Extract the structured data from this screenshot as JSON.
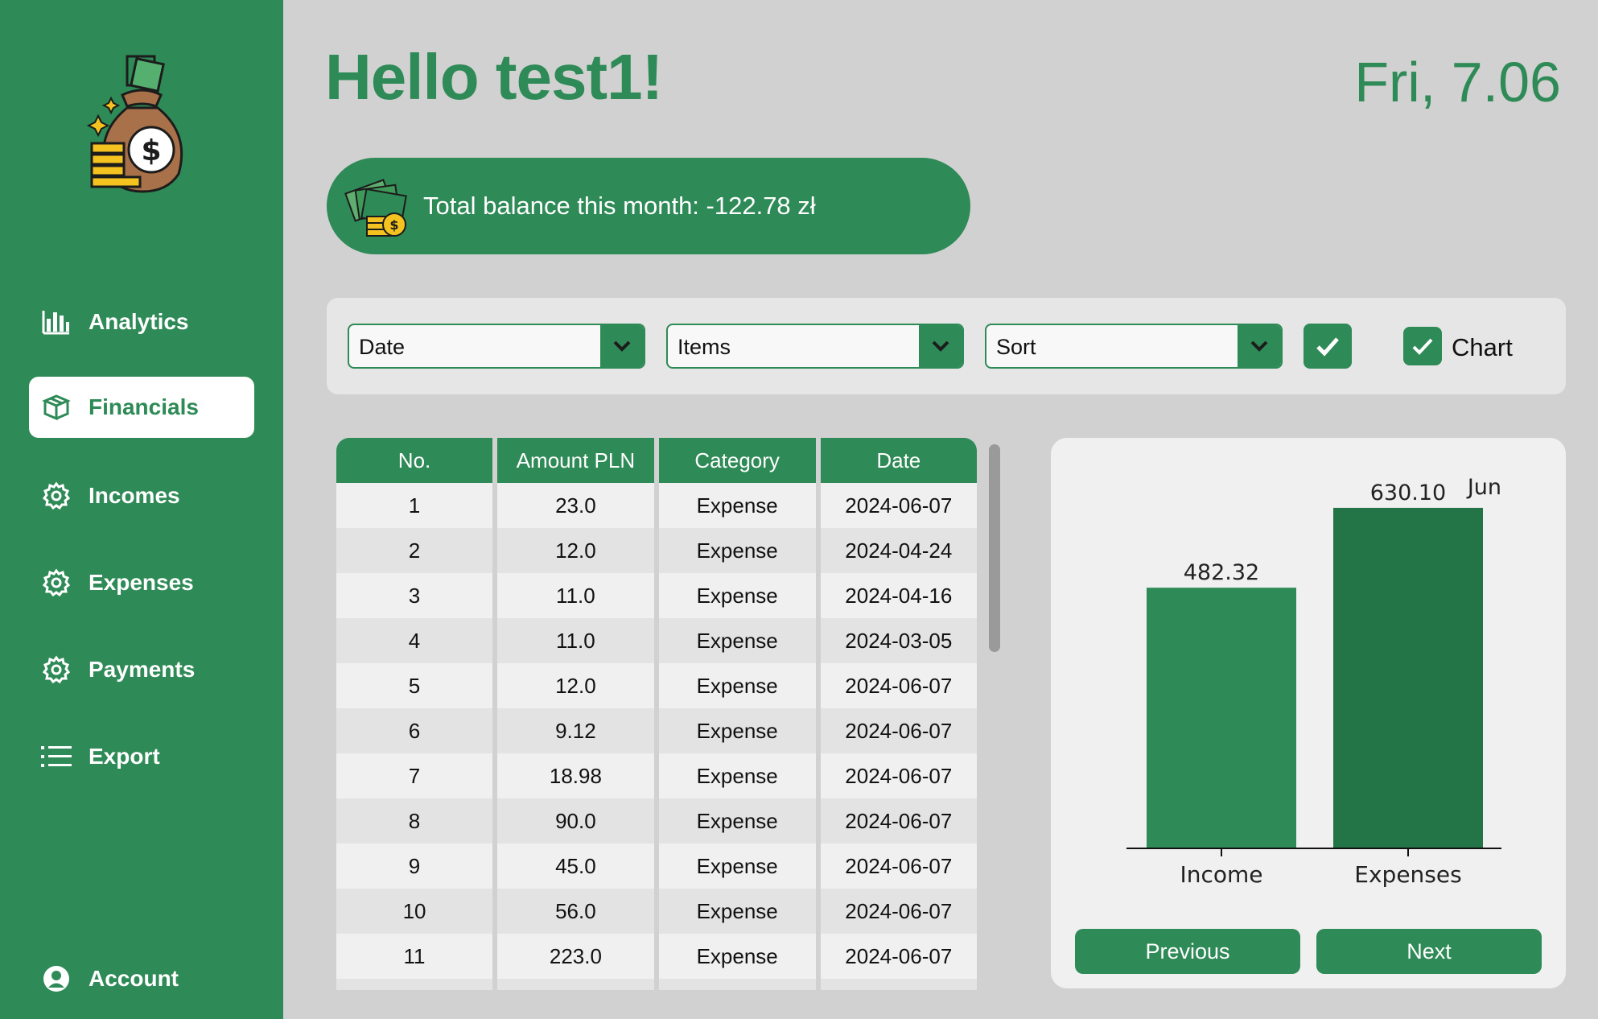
{
  "sidebar": {
    "logo_icon": "money-bag-icon",
    "items": [
      {
        "label": "Analytics",
        "icon": "bar-chart-icon"
      },
      {
        "label": "Financials",
        "icon": "box-icon",
        "active": true
      },
      {
        "label": "Incomes",
        "icon": "gear-icon"
      },
      {
        "label": "Expenses",
        "icon": "gear-icon"
      },
      {
        "label": "Payments",
        "icon": "gear-icon"
      },
      {
        "label": "Export",
        "icon": "list-icon"
      }
    ],
    "account": {
      "label": "Account",
      "icon": "user-icon"
    }
  },
  "header": {
    "greeting": "Hello test1!",
    "date": "Fri, 7.06"
  },
  "balance": {
    "text": "Total balance this month: -122.78 zł",
    "icon": "cash-coins-icon"
  },
  "filters": {
    "date_select": "Date",
    "items_select": "Items",
    "sort_select": "Sort",
    "apply_icon": "check-icon",
    "chart_checkbox_label": "Chart",
    "chart_checked": true
  },
  "table": {
    "headers": [
      "No.",
      "Amount PLN",
      "Category",
      "Date"
    ],
    "rows": [
      [
        "1",
        "23.0",
        "Expense",
        "2024-06-07"
      ],
      [
        "2",
        "12.0",
        "Expense",
        "2024-04-24"
      ],
      [
        "3",
        "11.0",
        "Expense",
        "2024-04-16"
      ],
      [
        "4",
        "11.0",
        "Expense",
        "2024-03-05"
      ],
      [
        "5",
        "12.0",
        "Expense",
        "2024-06-07"
      ],
      [
        "6",
        "9.12",
        "Expense",
        "2024-06-07"
      ],
      [
        "7",
        "18.98",
        "Expense",
        "2024-06-07"
      ],
      [
        "8",
        "90.0",
        "Expense",
        "2024-06-07"
      ],
      [
        "9",
        "45.0",
        "Expense",
        "2024-06-07"
      ],
      [
        "10",
        "56.0",
        "Expense",
        "2024-06-07"
      ],
      [
        "11",
        "223.0",
        "Expense",
        "2024-06-07"
      ],
      [
        "",
        "",
        "",
        ""
      ]
    ]
  },
  "chart_data": {
    "type": "bar",
    "title": "Jun",
    "categories": [
      "Income",
      "Expenses"
    ],
    "values": [
      482.32,
      630.1
    ],
    "value_labels": [
      "482.32",
      "630.10"
    ],
    "colors": [
      "#2e8a56",
      "#237447"
    ],
    "ylim": [
      0,
      700
    ]
  },
  "chart_nav": {
    "previous": "Previous",
    "next": "Next"
  }
}
